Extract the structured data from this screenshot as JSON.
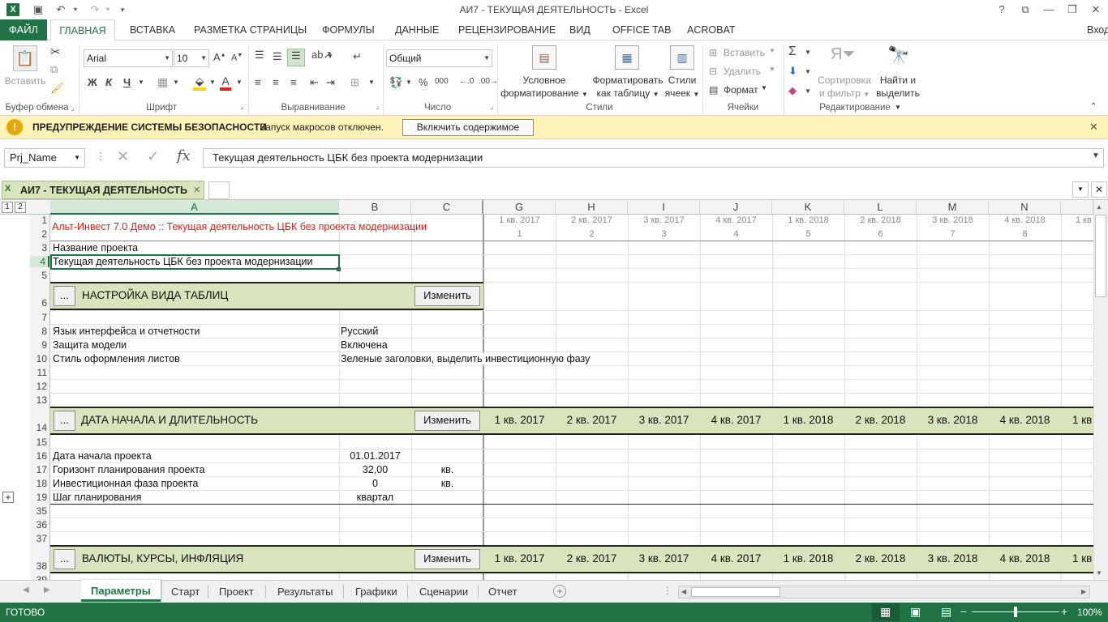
{
  "app": {
    "title": "АИ7 - ТЕКУЩАЯ ДЕЯТЕЛЬНОСТЬ - Excel",
    "help": "?",
    "signin": "Вход"
  },
  "ribbon_tabs": [
    "ФАЙЛ",
    "ГЛАВНАЯ",
    "ВСТАВКА",
    "РАЗМЕТКА СТРАНИЦЫ",
    "ФОРМУЛЫ",
    "ДАННЫЕ",
    "РЕЦЕНЗИРОВАНИЕ",
    "ВИД",
    "OFFICE TAB",
    "ACROBAT"
  ],
  "ribbon": {
    "paste": "Вставить",
    "font_name": "Arial",
    "font_size": "10",
    "bold": "Ж",
    "italic": "К",
    "underline": "Ч",
    "number_format": "Общий",
    "cond_format_1": "Условное",
    "cond_format_2": "форматирование",
    "format_table_1": "Форматировать",
    "format_table_2": "как таблицу",
    "cell_styles_1": "Стили",
    "cell_styles_2": "ячеек",
    "insert": "Вставить",
    "delete": "Удалить",
    "format": "Формат",
    "sort_1": "Сортировка",
    "sort_2": "и фильтр",
    "find_1": "Найти и",
    "find_2": "выделить",
    "groups": {
      "clipboard": "Буфер обмена",
      "font": "Шрифт",
      "alignment": "Выравнивание",
      "number": "Число",
      "styles": "Стили",
      "cells": "Ячейки",
      "editing": "Редактирование"
    }
  },
  "security": {
    "title": "ПРЕДУПРЕЖДЕНИЕ СИСТЕМЫ БЕЗОПАСНОСТИ",
    "message": "Запуск макросов отключен.",
    "button": "Включить содержимое"
  },
  "formula_bar": {
    "name_box": "Prj_Name",
    "formula": "Текущая деятельность ЦБК без проекта модернизации",
    "fx": "fx"
  },
  "workbook_tab": {
    "title": "АИ7 - ТЕКУЩАЯ ДЕЯТЕЛЬНОСТЬ"
  },
  "outline_levels": [
    "1",
    "2"
  ],
  "columns": [
    "A",
    "B",
    "C",
    "G",
    "H",
    "I",
    "J",
    "K",
    "L",
    "M",
    "N"
  ],
  "quarters": [
    "1 кв. 2017",
    "2 кв. 2017",
    "3 кв. 2017",
    "4 кв. 2017",
    "1 кв. 2018",
    "2 кв. 2018",
    "3 кв. 2018",
    "4 кв. 2018",
    "1 кв"
  ],
  "period_numbers": [
    "1",
    "2",
    "3",
    "4",
    "5",
    "6",
    "7",
    "8"
  ],
  "rows": {
    "r1": "1",
    "r2": "2",
    "r3": "3",
    "r4": "4",
    "r5": "5",
    "r6": "6",
    "r7": "7",
    "r8": "8",
    "r9": "9",
    "r10": "10",
    "r11": "11",
    "r12": "12",
    "r13": "13",
    "r14": "14",
    "r15": "15",
    "r16": "16",
    "r17": "17",
    "r18": "18",
    "r19": "19",
    "r35": "35",
    "r36": "36",
    "r37": "37",
    "r38": "38",
    "r39": "39"
  },
  "cells": {
    "a1": "Альт-Инвест 7.0 Демо :: Текущая деятельность ЦБК без проекта модернизации",
    "a3": "Название проекта",
    "a4": "Текущая деятельность ЦБК без проекта модернизации",
    "a8": "Язык интерфейса и отчетности",
    "b8": "Русский",
    "a9": "Защита модели",
    "b9": "Включена",
    "a10": "Стиль оформления листов",
    "b10": "Зеленые заголовки, выделить инвестиционную фазу",
    "a16": "Дата начала проекта",
    "b16": "01.01.2017",
    "a17": "Горизонт планирования проекта",
    "b17": "32,00",
    "c17": "кв.",
    "a18": "Инвестиционная фаза проекта",
    "b18": "0",
    "c18": "кв.",
    "a19": "Шаг планирования",
    "b19": "квартал"
  },
  "sections": {
    "s1": {
      "title": "НАСТРОЙКА ВИДА ТАБЛИЦ",
      "dots": "...",
      "change": "Изменить"
    },
    "s2": {
      "title": "ДАТА НАЧАЛА И ДЛИТЕЛЬНОСТЬ",
      "dots": "...",
      "change": "Изменить"
    },
    "s3": {
      "title": "ВАЛЮТЫ, КУРСЫ, ИНФЛЯЦИЯ",
      "dots": "...",
      "change": "Изменить"
    }
  },
  "sheet_tabs": [
    "Параметры",
    "Старт",
    "Проект",
    "Результаты",
    "Графики",
    "Сценарии",
    "Отчет"
  ],
  "status": {
    "ready": "ГОТОВО",
    "zoom": "100%"
  },
  "colors": {
    "excel_green": "#217346",
    "section_band": "#d8e4bc",
    "title_red": "#e0201b",
    "warning_bar": "#fff3b8"
  }
}
